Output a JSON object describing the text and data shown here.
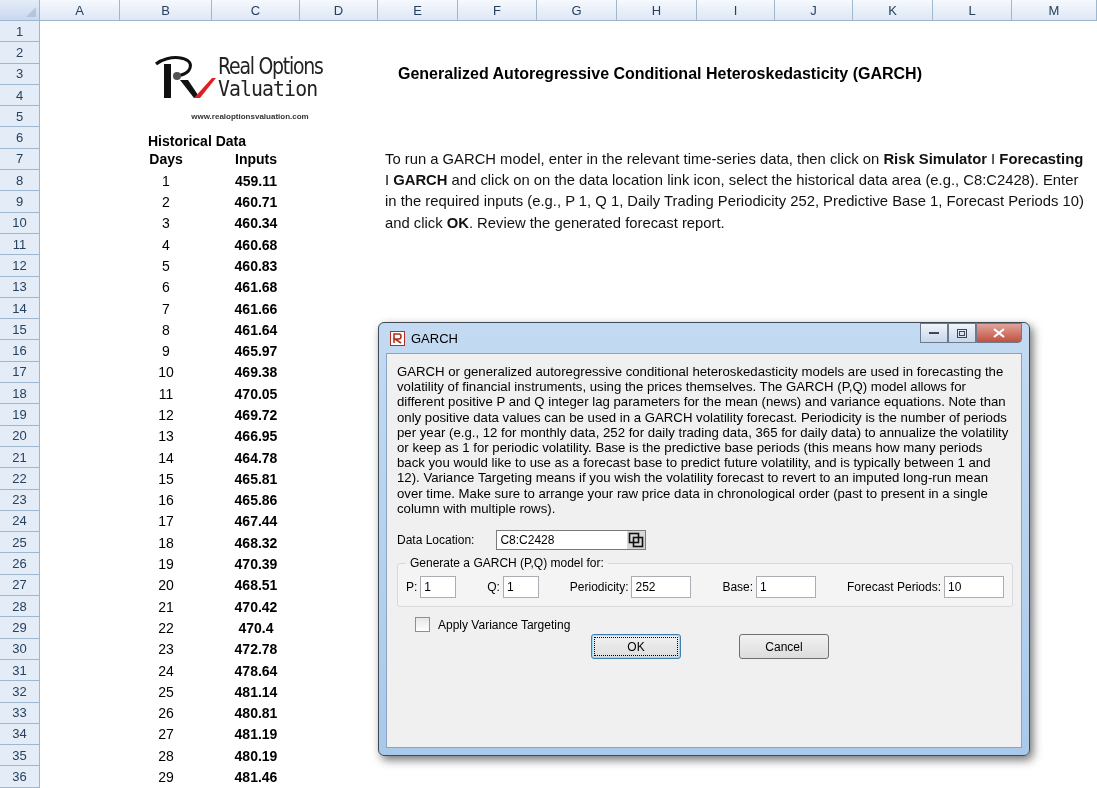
{
  "sheet": {
    "columns": [
      "A",
      "B",
      "C",
      "D",
      "E",
      "F",
      "G",
      "H",
      "I",
      "J",
      "K",
      "L",
      "M"
    ],
    "rows": [
      "1",
      "2",
      "3",
      "4",
      "5",
      "6",
      "7",
      "8",
      "9",
      "10",
      "11",
      "12",
      "13",
      "14",
      "15",
      "16",
      "17",
      "18",
      "19",
      "20",
      "21",
      "22",
      "23",
      "24",
      "25",
      "26",
      "27",
      "28",
      "29",
      "30",
      "31",
      "32",
      "33",
      "34",
      "35",
      "36"
    ]
  },
  "logo": {
    "line1": "Real Options",
    "line2": "Valuation",
    "url": "www.realoptionsvaluation.com"
  },
  "title": "Generalized Autoregressive Conditional Heteroskedasticity (GARCH)",
  "instructions": "To run a GARCH model, enter in the relevant time-series data, then click on **Risk Simulator** I **Forecasting** I **GARCH** and click on on the data location link icon, select the historical data area (e.g., C8:C2428). Enter in the required inputs (e.g., P 1, Q 1, Daily Trading Periodicity 252, Predictive Base 1, Forecast Periods 10) and click **OK**. Review the generated forecast report.",
  "historical": {
    "heading": "Historical Data",
    "columns": [
      "Days",
      "Inputs"
    ],
    "rows": [
      [
        "1",
        "459.11"
      ],
      [
        "2",
        "460.71"
      ],
      [
        "3",
        "460.34"
      ],
      [
        "4",
        "460.68"
      ],
      [
        "5",
        "460.83"
      ],
      [
        "6",
        "461.68"
      ],
      [
        "7",
        "461.66"
      ],
      [
        "8",
        "461.64"
      ],
      [
        "9",
        "465.97"
      ],
      [
        "10",
        "469.38"
      ],
      [
        "11",
        "470.05"
      ],
      [
        "12",
        "469.72"
      ],
      [
        "13",
        "466.95"
      ],
      [
        "14",
        "464.78"
      ],
      [
        "15",
        "465.81"
      ],
      [
        "16",
        "465.86"
      ],
      [
        "17",
        "467.44"
      ],
      [
        "18",
        "468.32"
      ],
      [
        "19",
        "470.39"
      ],
      [
        "20",
        "468.51"
      ],
      [
        "21",
        "470.42"
      ],
      [
        "22",
        "470.4"
      ],
      [
        "23",
        "472.78"
      ],
      [
        "24",
        "478.64"
      ],
      [
        "25",
        "481.14"
      ],
      [
        "26",
        "480.81"
      ],
      [
        "27",
        "481.19"
      ],
      [
        "28",
        "480.19"
      ],
      [
        "29",
        "481.46"
      ]
    ]
  },
  "dialog": {
    "title": "GARCH",
    "description": "GARCH or generalized autoregressive conditional heteroskedasticity models are used in forecasting the volatility of financial instruments, using the prices themselves. The GARCH (P,Q) model allows for different positive P and Q integer lag parameters for the mean (news) and variance equations. Note than only positive data values can be used in a GARCH volatility forecast. Periodicity is the number of periods per year (e.g., 12 for monthly data, 252 for daily trading data, 365 for daily data) to annualize the volatility or keep as 1 for periodic volatility. Base is the predictive base periods (this means how many periods back you would like to use as a forecast base to predict future volatility, and is typically between 1 and 12). Variance Targeting means if you wish the volatility forecast to revert to an imputed long-run mean over time. Make sure to arrange your raw price data in chronological order (past to present in a single column with multiple rows).",
    "data_location": {
      "label": "Data Location:",
      "value": "C8:C2428"
    },
    "group": {
      "title": "Generate a GARCH (P,Q) model for:",
      "fields": [
        {
          "label": "P:",
          "value": "1"
        },
        {
          "label": "Q:",
          "value": "1"
        },
        {
          "label": "Periodicity:",
          "value": "252"
        },
        {
          "label": "Base:",
          "value": "1"
        },
        {
          "label": "Forecast Periods:",
          "value": "10"
        }
      ]
    },
    "checkbox": {
      "label": "Apply Variance Targeting",
      "checked": false
    },
    "buttons": [
      {
        "label": "OK",
        "default": true
      },
      {
        "label": "Cancel",
        "default": false
      }
    ]
  }
}
